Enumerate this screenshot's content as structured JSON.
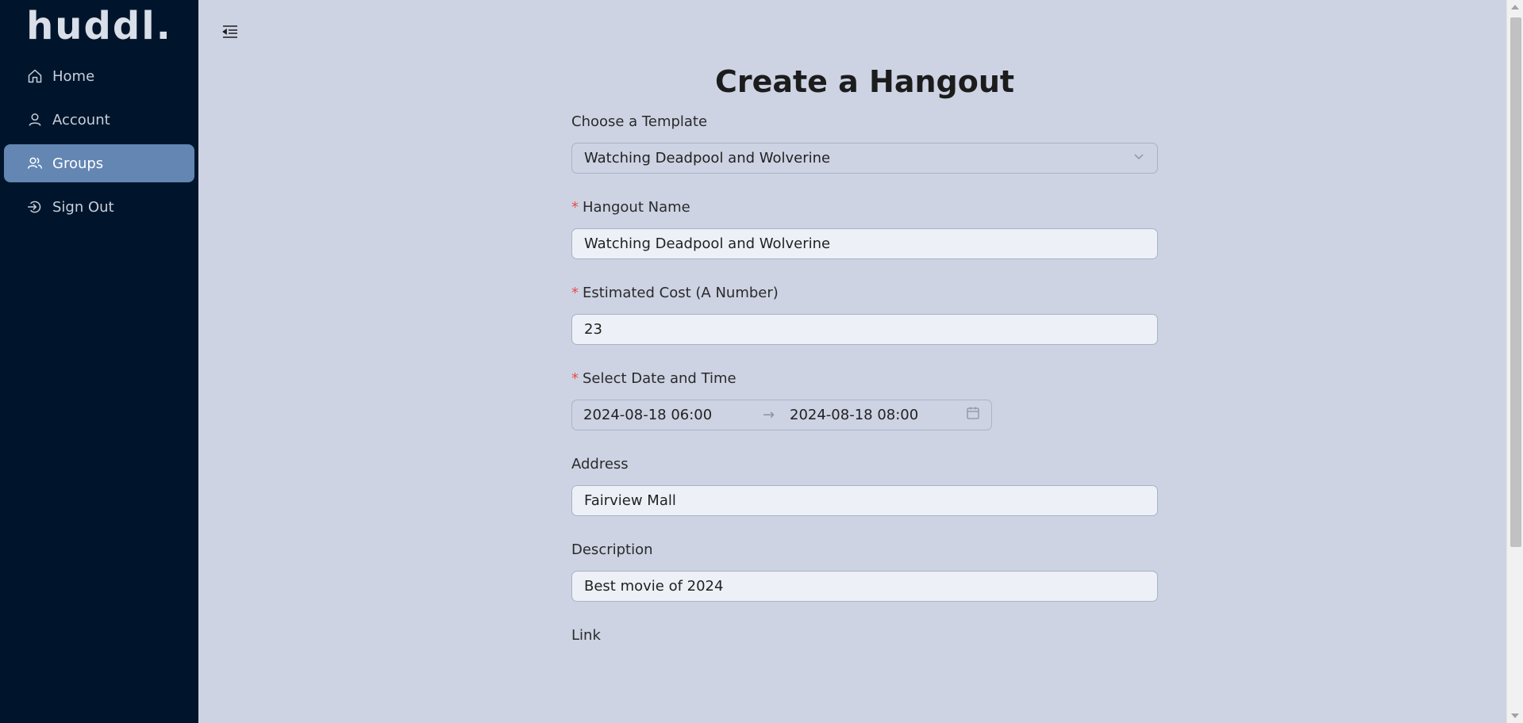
{
  "brand": {
    "name": "huddl."
  },
  "sidebar": {
    "items": [
      {
        "label": "Home",
        "icon": "home-icon",
        "active": false
      },
      {
        "label": "Account",
        "icon": "user-icon",
        "active": false
      },
      {
        "label": "Groups",
        "icon": "users-icon",
        "active": true
      },
      {
        "label": "Sign Out",
        "icon": "sign-out-icon",
        "active": false
      }
    ]
  },
  "main": {
    "title": "Create a Hangout",
    "form": {
      "template": {
        "label": "Choose a Template",
        "value": "Watching Deadpool and Wolverine"
      },
      "name": {
        "label": "Hangout Name",
        "value": "Watching Deadpool and Wolverine",
        "required": true
      },
      "cost": {
        "label": "Estimated Cost (A Number)",
        "value": "23",
        "required": true
      },
      "datetime": {
        "label": "Select Date and Time",
        "start": "2024-08-18 06:00",
        "end": "2024-08-18 08:00",
        "arrow": "→",
        "required": true
      },
      "address": {
        "label": "Address",
        "value": "Fairview Mall"
      },
      "description": {
        "label": "Description",
        "value": "Best movie of 2024"
      },
      "link": {
        "label": "Link"
      }
    }
  },
  "required_mark": "*",
  "colors": {
    "sidebar_bg": "#00152b",
    "active_item": "#6386b3",
    "page_bg": "#cdd3e3",
    "required": "#e84c4c"
  }
}
